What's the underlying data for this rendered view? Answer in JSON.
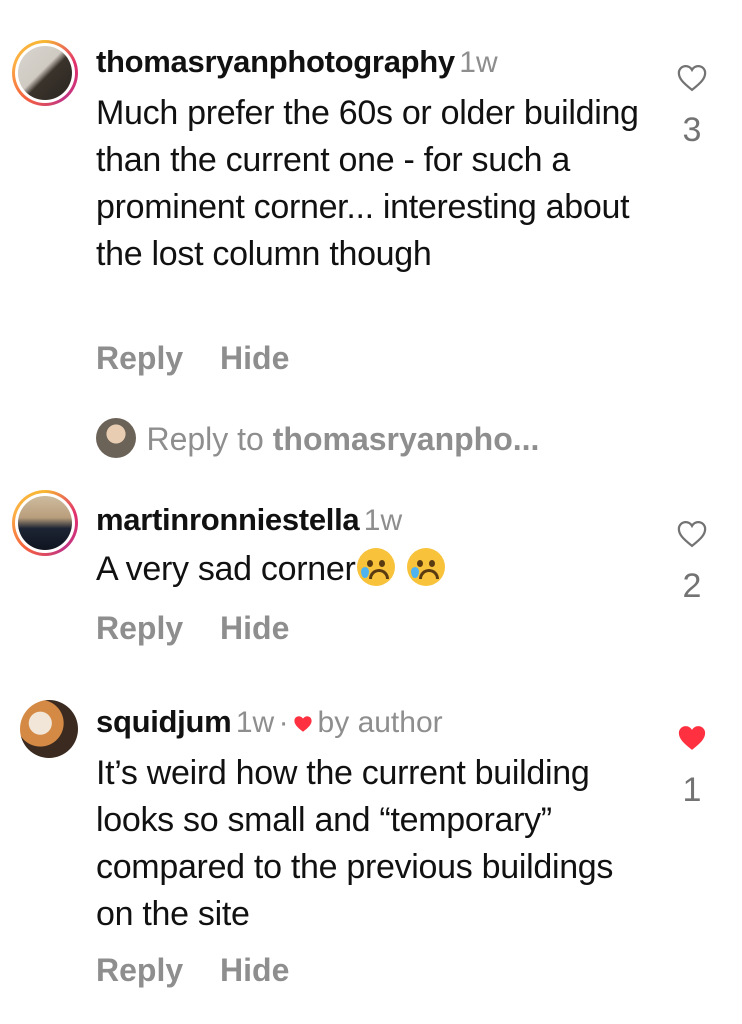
{
  "comments": [
    {
      "username": "thomasryanphotography",
      "time": "1w",
      "text": "Much prefer the 60s or older building than the current one - for such a prominent corner... interesting about the lost column though",
      "reply_label": "Reply",
      "hide_label": "Hide",
      "likes": "3"
    },
    {
      "username": "martinronniestella",
      "time": "1w",
      "text": "A very sad corner",
      "reply_label": "Reply",
      "hide_label": "Hide",
      "likes": "2"
    },
    {
      "username": "squidjum",
      "time": "1w",
      "separator": "·",
      "author_badge": "by author",
      "text": "It’s weird how the current building looks so small and “temporary” compared to the previous buildings on the site",
      "reply_label": "Reply",
      "hide_label": "Hide",
      "likes": "1"
    }
  ],
  "reply_prompt": {
    "prefix": "Reply to ",
    "target": "thomasryanpho..."
  },
  "icons": {
    "like": "heart-outline-icon",
    "liked": "heart-filled-icon",
    "emoji": "crying-face-emoji"
  },
  "colors": {
    "liked_heart": "#ff3040",
    "muted_text": "#8e8e8e"
  }
}
